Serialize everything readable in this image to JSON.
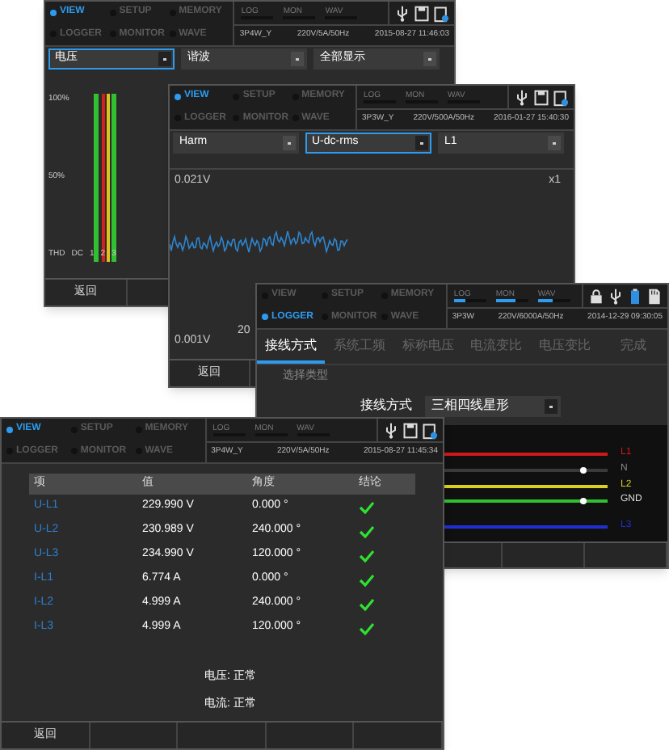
{
  "windows": [
    {
      "kind": "harmonic",
      "header": {
        "modes": [
          {
            "label": "VIEW",
            "selected": true
          },
          {
            "label": "SETUP",
            "selected": false
          },
          {
            "label": "MEMORY",
            "selected": false
          },
          {
            "label": "LOGGER",
            "selected": false
          },
          {
            "label": "MONITOR",
            "selected": false
          },
          {
            "label": "WAVE",
            "selected": false
          }
        ],
        "indicators": [
          {
            "label": "LOG",
            "level": 0
          },
          {
            "label": "MON",
            "level": 0
          },
          {
            "label": "WAV",
            "level": 0
          }
        ],
        "wiring": "3P4W_Y",
        "rating": "220V/5A/50Hz",
        "datetime": "2015-08-27 11:46:03",
        "locked": false
      },
      "dropdowns": [
        {
          "value": "电压",
          "focused": true
        },
        {
          "value": "谐波",
          "focused": false
        },
        {
          "value": "全部显示",
          "focused": false
        }
      ],
      "y_labels": [
        "100%",
        "50%"
      ],
      "x_labels": [
        "THD",
        "DC",
        "1",
        "2",
        "3"
      ],
      "footer": [
        "返回"
      ]
    },
    {
      "kind": "waveform",
      "header": {
        "modes": [
          {
            "label": "VIEW",
            "selected": true
          },
          {
            "label": "SETUP",
            "selected": false
          },
          {
            "label": "MEMORY",
            "selected": false
          },
          {
            "label": "LOGGER",
            "selected": false
          },
          {
            "label": "MONITOR",
            "selected": false
          },
          {
            "label": "WAVE",
            "selected": false
          }
        ],
        "indicators": [
          {
            "label": "LOG",
            "level": 0
          },
          {
            "label": "MON",
            "level": 0
          },
          {
            "label": "WAV",
            "level": 0
          }
        ],
        "wiring": "3P3W_Y",
        "rating": "220V/500A/50Hz",
        "datetime": "2016-01-27 15:40:30",
        "locked": false
      },
      "dropdowns": [
        {
          "value": "Harm",
          "focused": false
        },
        {
          "value": "U-dc-rms",
          "focused": true
        },
        {
          "value": "L1",
          "focused": false
        }
      ],
      "scale_top": "0.021V",
      "zoom": "x1",
      "scale_bottom": "0.001V",
      "x_label": "20",
      "footer": [
        "返回"
      ]
    },
    {
      "kind": "wiring",
      "header": {
        "modes": [
          {
            "label": "VIEW",
            "selected": false
          },
          {
            "label": "SETUP",
            "selected": false
          },
          {
            "label": "MEMORY",
            "selected": false
          },
          {
            "label": "LOGGER",
            "selected": true
          },
          {
            "label": "MONITOR",
            "selected": false
          },
          {
            "label": "WAVE",
            "selected": false
          }
        ],
        "indicators": [
          {
            "label": "LOG",
            "level": 0.35
          },
          {
            "label": "MON",
            "level": 0.6
          },
          {
            "label": "WAV",
            "level": 0.45
          }
        ],
        "wiring": "3P3W",
        "rating": "220V/6000A/50Hz",
        "datetime": "2014-12-29 09:30:05",
        "locked": true
      },
      "tabs": [
        {
          "label": "接线方式",
          "selected": true
        },
        {
          "label": "系统工频",
          "selected": false
        },
        {
          "label": "标称电压",
          "selected": false
        },
        {
          "label": "电流变比",
          "selected": false
        },
        {
          "label": "电压变比",
          "selected": false
        },
        {
          "label": "完成",
          "selected": false
        }
      ],
      "section": "选择类型",
      "field": {
        "label": "接线方式",
        "value": "三相四线星形"
      },
      "lines": [
        {
          "label": "L1",
          "color": "#d01818"
        },
        {
          "label": "N",
          "color": "#3a3a3a"
        },
        {
          "label": "L2",
          "color": "#d8d020"
        },
        {
          "label": "GND",
          "color": "#30c030"
        },
        {
          "label": "L3",
          "color": "#2030d0"
        }
      ]
    },
    {
      "kind": "check",
      "header": {
        "modes": [
          {
            "label": "VIEW",
            "selected": true
          },
          {
            "label": "SETUP",
            "selected": false
          },
          {
            "label": "MEMORY",
            "selected": false
          },
          {
            "label": "LOGGER",
            "selected": false
          },
          {
            "label": "MONITOR",
            "selected": false
          },
          {
            "label": "WAVE",
            "selected": false
          }
        ],
        "indicators": [
          {
            "label": "LOG",
            "level": 0
          },
          {
            "label": "MON",
            "level": 0
          },
          {
            "label": "WAV",
            "level": 0
          }
        ],
        "wiring": "3P4W_Y",
        "rating": "220V/5A/50Hz",
        "datetime": "2015-08-27 11:45:34",
        "locked": false
      },
      "table": {
        "columns": [
          "项",
          "值",
          "角度",
          "结论"
        ],
        "rows": [
          {
            "item": "U-L1",
            "value": "229.990 V",
            "angle": "0.000 °",
            "ok": true
          },
          {
            "item": "U-L2",
            "value": "230.989 V",
            "angle": "240.000 °",
            "ok": true
          },
          {
            "item": "U-L3",
            "value": "234.990 V",
            "angle": "120.000 °",
            "ok": true
          },
          {
            "item": "I-L1",
            "value": "6.774 A",
            "angle": "0.000 °",
            "ok": true
          },
          {
            "item": "I-L2",
            "value": "4.999 A",
            "angle": "240.000 °",
            "ok": true
          },
          {
            "item": "I-L3",
            "value": "4.999 A",
            "angle": "120.000 °",
            "ok": true
          }
        ]
      },
      "summary": [
        "电压: 正常",
        "电流: 正常"
      ],
      "footer": [
        "返回"
      ]
    }
  ]
}
